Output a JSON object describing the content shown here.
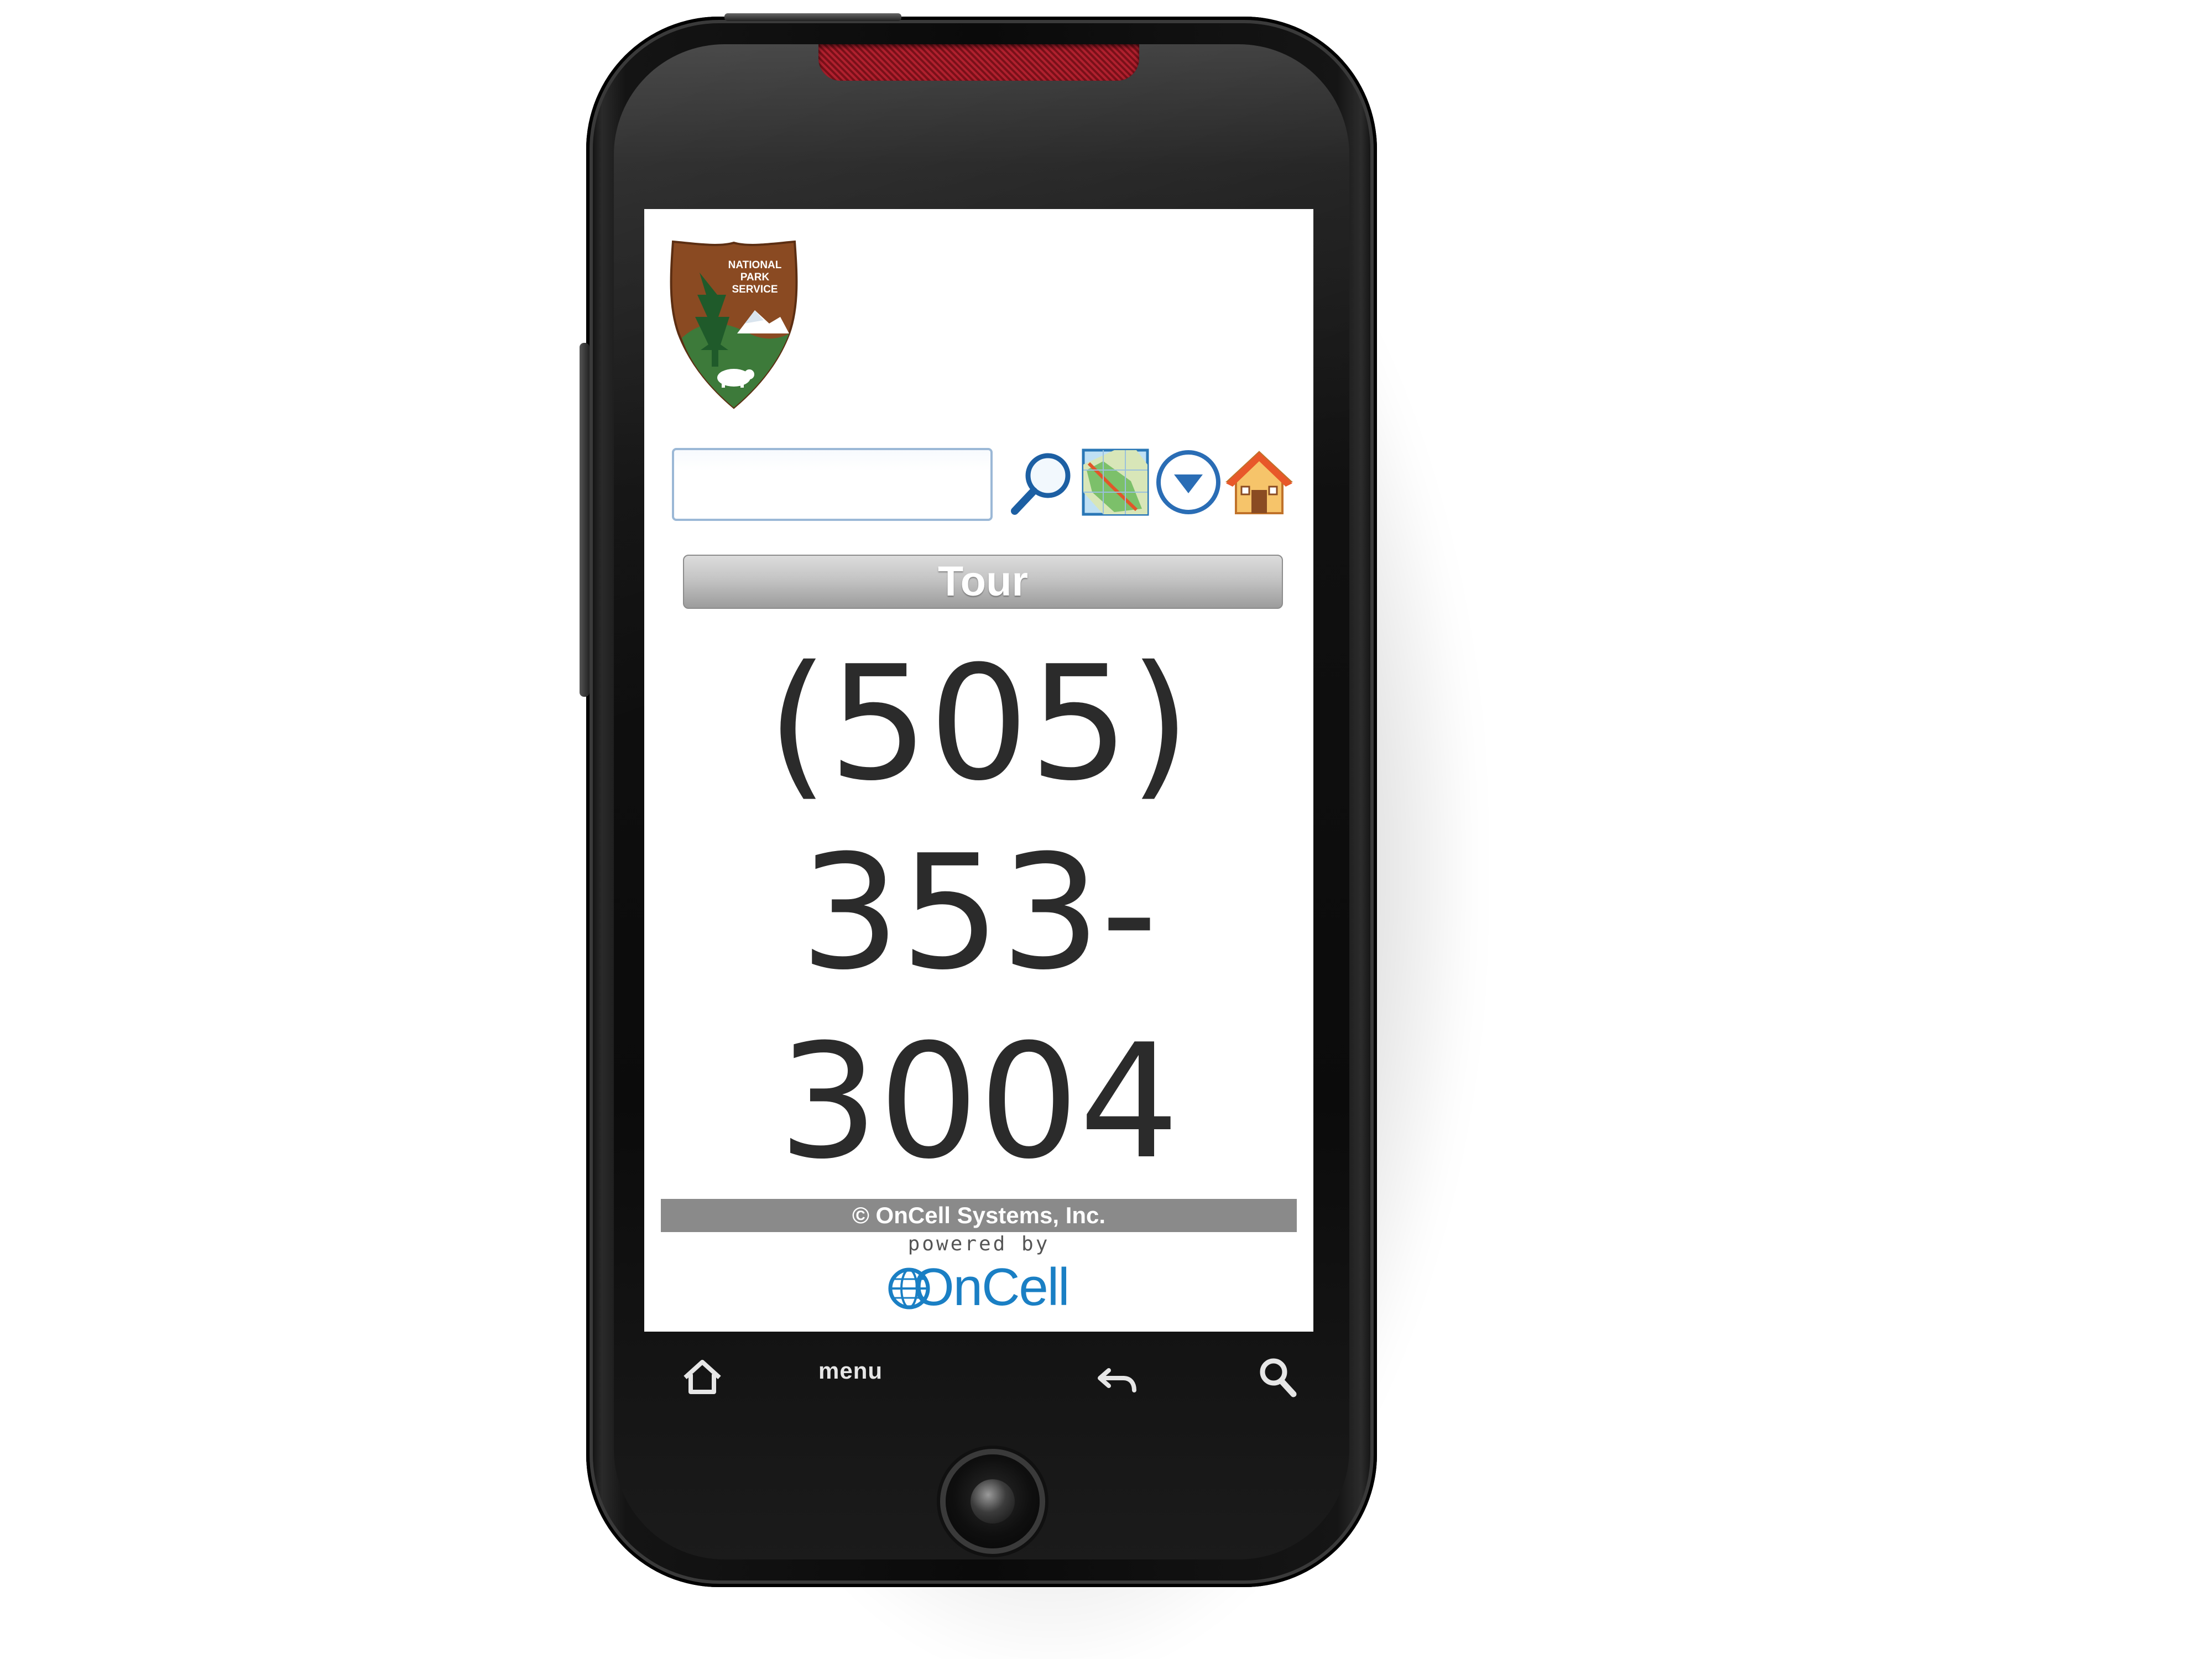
{
  "app": {
    "logo": {
      "icon": "nps-arrowhead-icon",
      "text": "NATIONAL PARK SERVICE"
    }
  },
  "toolbar": {
    "search_value": "",
    "search_placeholder": "",
    "icons": [
      "search-icon",
      "map-icon",
      "dropdown-menu-icon",
      "home-icon"
    ]
  },
  "section": {
    "title": "Tour"
  },
  "content": {
    "phone_number": "(505) 353- 3004"
  },
  "footer": {
    "copyright": "© OnCell Systems, Inc.",
    "powered_by": "powered by",
    "brand": "OnCell"
  },
  "device": {
    "menu_label": "menu",
    "buttons": [
      "home-icon",
      "menu",
      "back-icon",
      "search-icon"
    ]
  },
  "colors": {
    "tour_bar": "#b8b8b8",
    "copyright_bar": "#8a8a8a",
    "brand_blue": "#1a7fc4",
    "speaker_red": "#b0202e"
  }
}
